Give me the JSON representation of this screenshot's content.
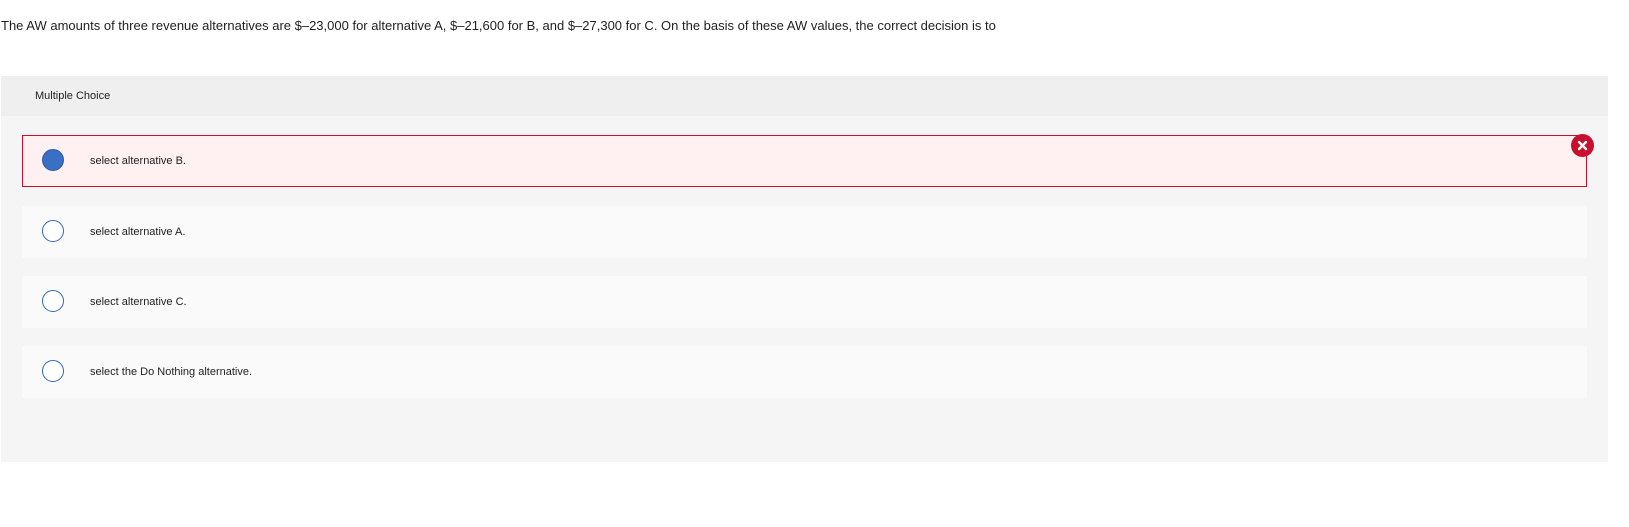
{
  "question": {
    "text": "The AW amounts of three revenue alternatives are $–23,000 for alternative A, $–21,600 for B, and $–27,300 for C. On the basis of these AW values, the correct decision is to"
  },
  "panel": {
    "title": "Multiple Choice"
  },
  "choices": [
    {
      "label": "select alternative B.",
      "selected": true,
      "status": "incorrect"
    },
    {
      "label": "select alternative A.",
      "selected": false
    },
    {
      "label": "select alternative C.",
      "selected": false
    },
    {
      "label": "select the Do Nothing alternative.",
      "selected": false
    }
  ],
  "colors": {
    "incorrect": "#c8102e",
    "radio_border": "#3466b8",
    "radio_selected_fill": "#3a6fc4",
    "incorrect_background": "#fff0f2"
  },
  "icons": {
    "incorrect_marker": "close-x-icon"
  }
}
